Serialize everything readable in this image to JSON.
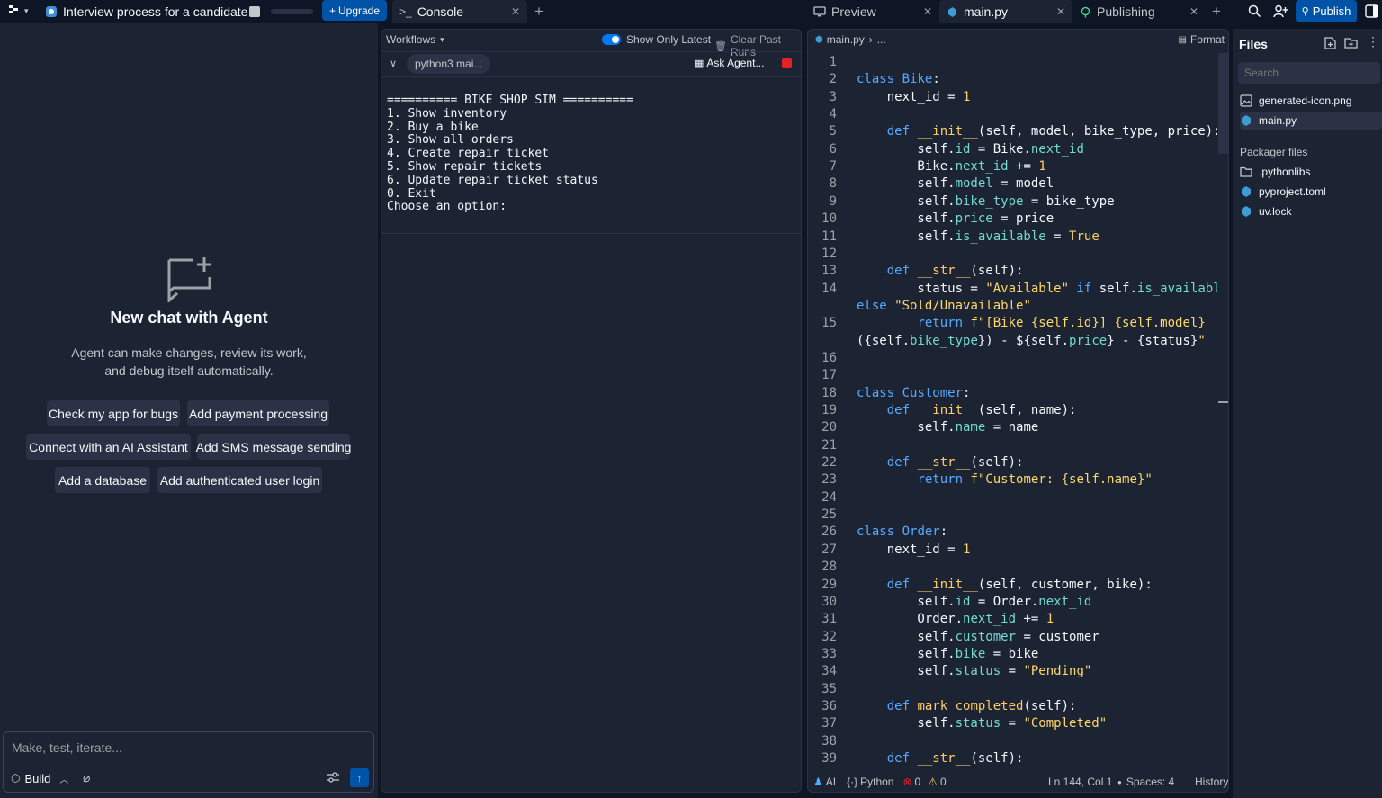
{
  "topbar": {
    "project_title": "Interview process for a candidate",
    "upgrade_label": "Upgrade",
    "tabs_left": [
      {
        "label": "Console",
        "icon": "terminal-icon"
      }
    ],
    "tabs_right": [
      {
        "label": "Preview",
        "icon": "preview-icon"
      },
      {
        "label": "main.py",
        "icon": "python-icon"
      },
      {
        "label": "Publishing",
        "icon": "publishing-icon"
      }
    ],
    "publish_label": "Publish"
  },
  "agent": {
    "heading": "New chat with Agent",
    "description": "Agent can make changes, review its work, and debug itself automatically.",
    "suggestions": [
      [
        "Check my app for bugs",
        "Add payment processing"
      ],
      [
        "Connect with an AI Assistant",
        "Add SMS message sending"
      ],
      [
        "Add a database",
        "Add authenticated user login"
      ]
    ],
    "input_placeholder": "Make, test, iterate...",
    "mode_label": "Build"
  },
  "console": {
    "workflows_label": "Workflows",
    "show_latest_label": "Show Only Latest",
    "clear_runs_label": "Clear Past Runs",
    "run_name": "python3 mai...",
    "ask_agent_label": "Ask Agent...",
    "output": "========== BIKE SHOP SIM ==========\n1. Show inventory\n2. Buy a bike\n3. Show all orders\n4. Create repair ticket\n5. Show repair tickets\n6. Update repair ticket status\n0. Exit\nChoose an option:"
  },
  "editor": {
    "breadcrumb": "main.py",
    "breadcrumb_rest": "...",
    "format_label": "Format",
    "status": {
      "ai": "AI",
      "language": "Python",
      "errors": "0",
      "warnings": "0",
      "position": "Ln 144, Col 1",
      "spaces": "Spaces: 4",
      "history": "History"
    },
    "lines": [
      {
        "n": "1",
        "t": ""
      },
      {
        "n": "2",
        "t": "class Bike:"
      },
      {
        "n": "3",
        "t": "    next_id = 1"
      },
      {
        "n": "4",
        "t": ""
      },
      {
        "n": "5",
        "t": "    def __init__(self, model, bike_type, price):"
      },
      {
        "n": "6",
        "t": "        self.id = Bike.next_id"
      },
      {
        "n": "7",
        "t": "        Bike.next_id += 1"
      },
      {
        "n": "8",
        "t": "        self.model = model"
      },
      {
        "n": "9",
        "t": "        self.bike_type = bike_type"
      },
      {
        "n": "10",
        "t": "        self.price = price"
      },
      {
        "n": "11",
        "t": "        self.is_available = True"
      },
      {
        "n": "12",
        "t": ""
      },
      {
        "n": "13",
        "t": "    def __str__(self):"
      },
      {
        "n": "14",
        "t": "        status = \"Available\" if self.is_available"
      },
      {
        "n": "",
        "t": "else \"Sold/Unavailable\""
      },
      {
        "n": "15",
        "t": "        return f\"[Bike {self.id}] {self.model}"
      },
      {
        "n": "",
        "t": "({self.bike_type}) - ${self.price} - {status}\""
      },
      {
        "n": "16",
        "t": ""
      },
      {
        "n": "17",
        "t": ""
      },
      {
        "n": "18",
        "t": "class Customer:"
      },
      {
        "n": "19",
        "t": "    def __init__(self, name):"
      },
      {
        "n": "20",
        "t": "        self.name = name"
      },
      {
        "n": "21",
        "t": ""
      },
      {
        "n": "22",
        "t": "    def __str__(self):"
      },
      {
        "n": "23",
        "t": "        return f\"Customer: {self.name}\""
      },
      {
        "n": "24",
        "t": ""
      },
      {
        "n": "25",
        "t": ""
      },
      {
        "n": "26",
        "t": "class Order:"
      },
      {
        "n": "27",
        "t": "    next_id = 1"
      },
      {
        "n": "28",
        "t": ""
      },
      {
        "n": "29",
        "t": "    def __init__(self, customer, bike):"
      },
      {
        "n": "30",
        "t": "        self.id = Order.next_id"
      },
      {
        "n": "31",
        "t": "        Order.next_id += 1"
      },
      {
        "n": "32",
        "t": "        self.customer = customer"
      },
      {
        "n": "33",
        "t": "        self.bike = bike"
      },
      {
        "n": "34",
        "t": "        self.status = \"Pending\""
      },
      {
        "n": "35",
        "t": ""
      },
      {
        "n": "36",
        "t": "    def mark_completed(self):"
      },
      {
        "n": "37",
        "t": "        self.status = \"Completed\""
      },
      {
        "n": "38",
        "t": ""
      },
      {
        "n": "39",
        "t": "    def __str__(self):"
      }
    ]
  },
  "files": {
    "title": "Files",
    "search_placeholder": "Search",
    "items": [
      {
        "name": "generated-icon.png",
        "icon": "image-icon"
      },
      {
        "name": "main.py",
        "icon": "python-icon"
      }
    ],
    "packager_heading": "Packager files",
    "packager_items": [
      {
        "name": ".pythonlibs",
        "icon": "folder-icon"
      },
      {
        "name": "pyproject.toml",
        "icon": "python-icon"
      },
      {
        "name": "uv.lock",
        "icon": "python-icon"
      }
    ]
  },
  "colors": {
    "accent": "#0079f2",
    "brand_button": "#0053a6",
    "stop": "#e52222",
    "panel": "#1c2333",
    "background": "#0e1525"
  }
}
